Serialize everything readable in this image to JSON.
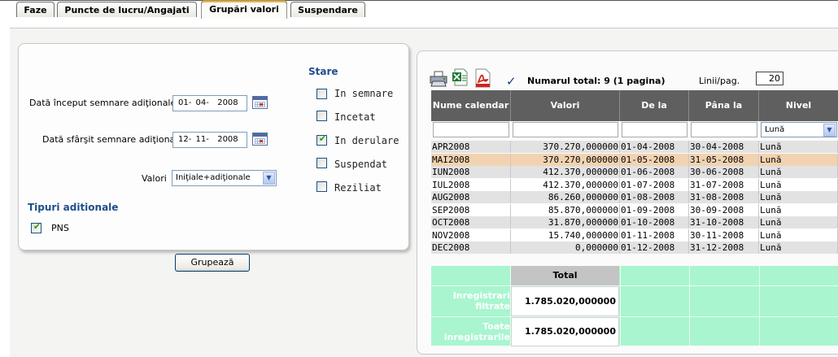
{
  "tabs": [
    {
      "label": "Faze"
    },
    {
      "label": "Puncte de lucru/Angajati"
    },
    {
      "label": "Grupări valori",
      "active": true
    },
    {
      "label": "Suspendare"
    }
  ],
  "filters": {
    "start_label": "Dată început semnare adiţionale",
    "start_value": "01- 04-  2008",
    "end_label": "Dată sfârşit semnare adiţionale",
    "end_value": "12- 11-  2008",
    "valori_label": "Valori",
    "valori_value": "Iniţiale+adiţionale",
    "tipuri_title": "Tipuri aditionale",
    "tipuri": [
      {
        "label": "PNS",
        "checked": true
      }
    ],
    "stare_title": "Stare",
    "stare": [
      {
        "label": "In semnare",
        "checked": false
      },
      {
        "label": "Incetat",
        "checked": false
      },
      {
        "label": "In derulare",
        "checked": true
      },
      {
        "label": "Suspendat",
        "checked": false
      },
      {
        "label": "Reziliat",
        "checked": false
      }
    ]
  },
  "group_button": "Grupează",
  "summary": {
    "total_text": "Numarul total: 9 (1 pagina)",
    "rows_label": "Linii/pag.",
    "rows_value": "20"
  },
  "grid": {
    "columns": [
      "Nume calendar",
      "Valori",
      "De la",
      "Pâna la",
      "Nivel"
    ],
    "nivel_filter": "Lună",
    "rows": [
      {
        "name": "APR2008",
        "value": "370.270,000000",
        "from": "01-04-2008",
        "to": "30-04-2008",
        "level": "Lună"
      },
      {
        "name": "MAI2008",
        "value": "370.270,000000",
        "from": "01-05-2008",
        "to": "31-05-2008",
        "level": "Lună",
        "highlight": true
      },
      {
        "name": "IUN2008",
        "value": "412.370,000000",
        "from": "01-06-2008",
        "to": "30-06-2008",
        "level": "Lună"
      },
      {
        "name": "IUL2008",
        "value": "412.370,000000",
        "from": "01-07-2008",
        "to": "31-07-2008",
        "level": "Lună"
      },
      {
        "name": "AUG2008",
        "value": "86.260,000000",
        "from": "01-08-2008",
        "to": "31-08-2008",
        "level": "Lună"
      },
      {
        "name": "SEP2008",
        "value": "85.870,000000",
        "from": "01-09-2008",
        "to": "30-09-2008",
        "level": "Lună"
      },
      {
        "name": "OCT2008",
        "value": "31.870,000000",
        "from": "01-10-2008",
        "to": "31-10-2008",
        "level": "Lună"
      },
      {
        "name": "NOV2008",
        "value": "15.740,000000",
        "from": "01-11-2008",
        "to": "30-11-2008",
        "level": "Lună"
      },
      {
        "name": "DEC2008",
        "value": "0,000000",
        "from": "01-12-2008",
        "to": "31-12-2008",
        "level": "Lună"
      }
    ],
    "total_header": "Total",
    "totals": [
      {
        "label": "Inregistrari filtrate",
        "value": "1.785.020,000000"
      },
      {
        "label": "Toate inregistrarile",
        "value": "1.785.020,000000"
      }
    ]
  },
  "icons": [
    "printer-icon",
    "excel-icon",
    "pdf-icon",
    "checkmark-icon",
    "calendar-icon",
    "chevron-down-icon"
  ],
  "colors": {
    "grid_header": "#5f5f5f",
    "row_highlight": "#f2d3b1",
    "totals_background": "#a9f5d0",
    "accent": "#1f4e8c"
  }
}
